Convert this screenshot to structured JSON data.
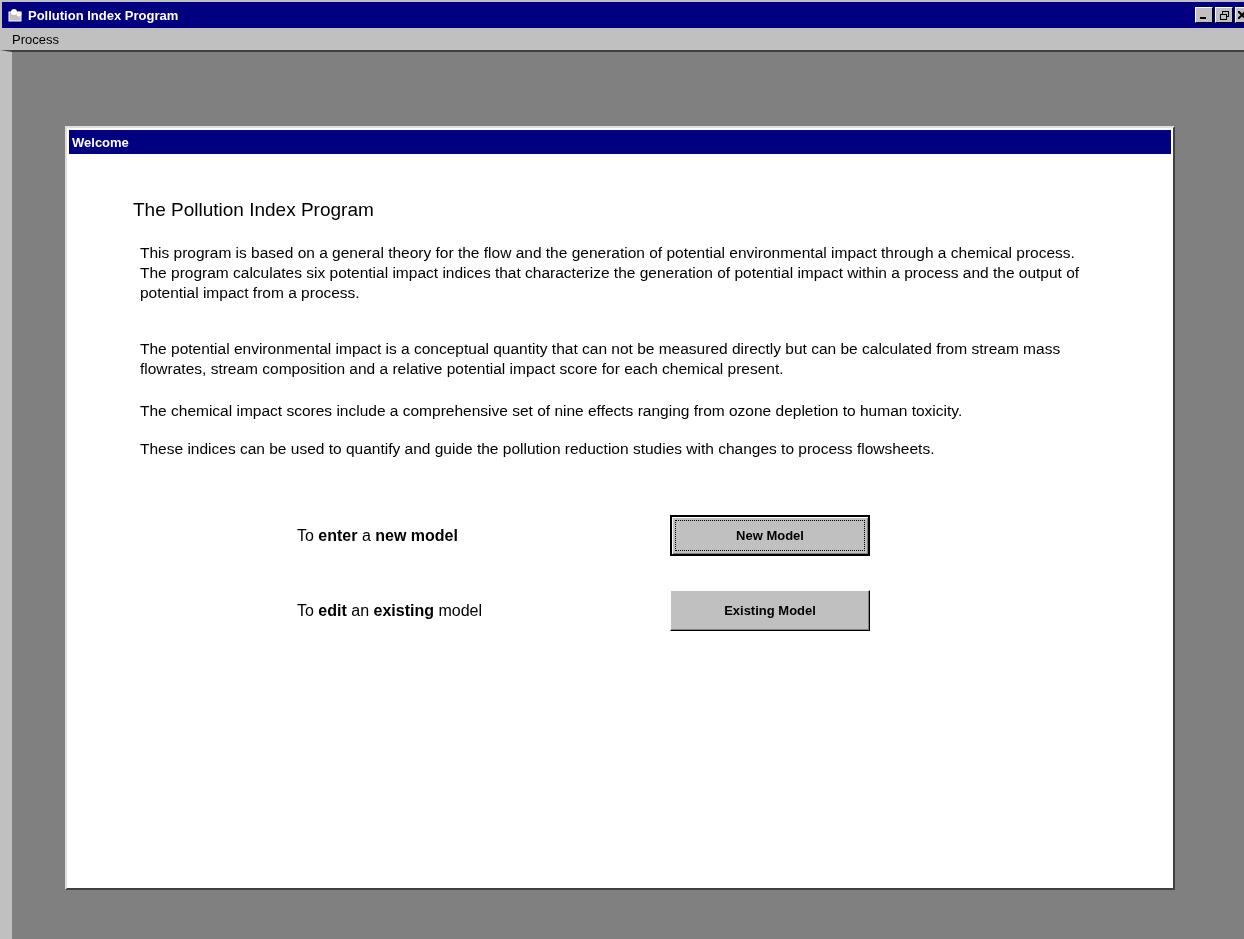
{
  "window": {
    "title": "Pollution Index Program"
  },
  "menu": [
    {
      "label": "Process"
    }
  ],
  "child_window": {
    "title": "Welcome"
  },
  "heading": "The Pollution Index Program",
  "paragraphs": [
    "This program is based on a general theory for the flow and the generation of potential environmental impact through a chemical process. The program calculates six potential impact indices that characterize the generation of potential impact within a process and the output of potential impact from a process.",
    "The potential environmental impact is a conceptual quantity that can not be measured directly but can be calculated from stream mass flowrates, stream composition and a relative potential impact score for each chemical present.",
    "The chemical impact scores include a comprehensive set of nine effects ranging from ozone depletion to human toxicity.",
    "These indices can be used to quantify and guide the pollution reduction studies with changes to process flowsheets."
  ],
  "actions": [
    {
      "prompt": "To **enter** a **new model**",
      "button": "New Model",
      "focused": true
    },
    {
      "prompt": "To **edit** an **existing** model",
      "button": "Existing Model",
      "focused": false
    }
  ]
}
